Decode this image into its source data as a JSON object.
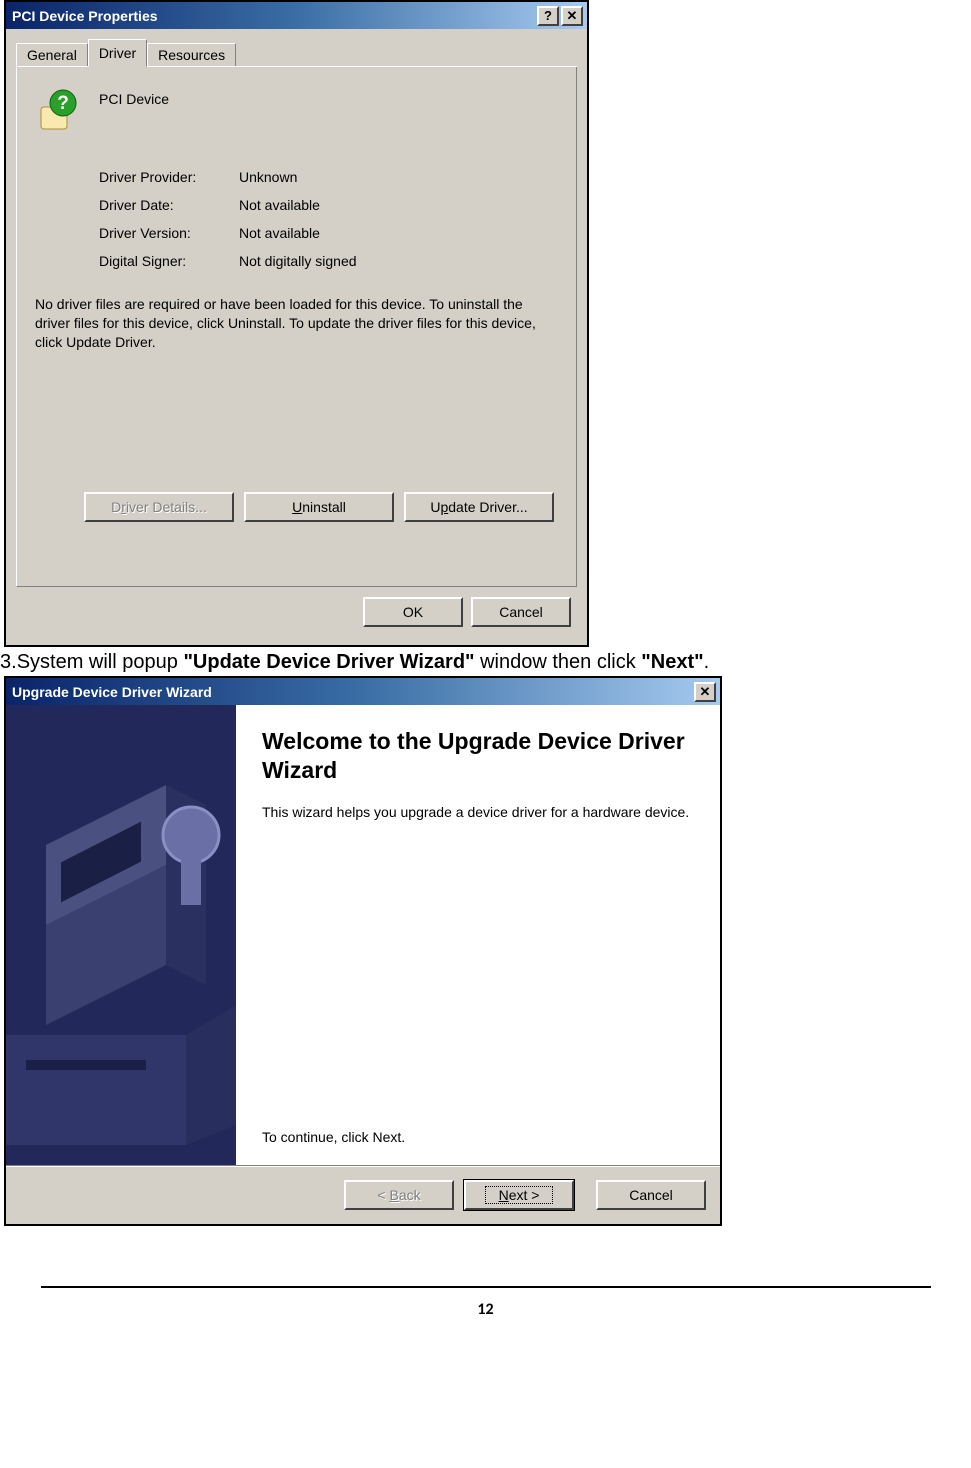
{
  "dlg1": {
    "title": "PCI Device Properties",
    "help_btn": "?",
    "close_btn": "✕",
    "tabs": {
      "general": "General",
      "driver": "Driver",
      "resources": "Resources"
    },
    "device_name": "PCI Device",
    "rows": {
      "provider_label": "Driver Provider:",
      "provider_value": "Unknown",
      "date_label": "Driver Date:",
      "date_value": "Not available",
      "version_label": "Driver Version:",
      "version_value": "Not available",
      "signer_label": "Digital Signer:",
      "signer_value": "Not digitally signed"
    },
    "note": "No driver files are required or have been loaded for this device. To uninstall the driver files for this device, click Uninstall. To update the driver files for this device, click Update Driver.",
    "buttons": {
      "details_pre": "D",
      "details_u": "r",
      "details_post": "iver Details...",
      "uninstall_pre": "",
      "uninstall_u": "U",
      "uninstall_post": "ninstall",
      "update_pre": "U",
      "update_u": "p",
      "update_post": "date Driver...",
      "ok": "OK",
      "cancel": "Cancel"
    }
  },
  "instruction": {
    "num": "3.",
    "t1": "System will popup ",
    "b1": "\"Update Device Driver Wizard\"",
    "t2": " window then click ",
    "b2": "\"Next\"",
    "t3": "."
  },
  "dlg2": {
    "title": "Upgrade Device Driver Wizard",
    "close_btn": "✕",
    "heading": "Welcome to the Upgrade Device Driver Wizard",
    "desc": "This wizard helps you upgrade a device driver for a hardware device.",
    "continue": "To continue, click Next.",
    "buttons": {
      "back_pre": "< ",
      "back_u": "B",
      "back_post": "ack",
      "next_pre": "",
      "next_u": "N",
      "next_post": "ext >",
      "cancel": "Cancel"
    }
  },
  "page_number": "12"
}
